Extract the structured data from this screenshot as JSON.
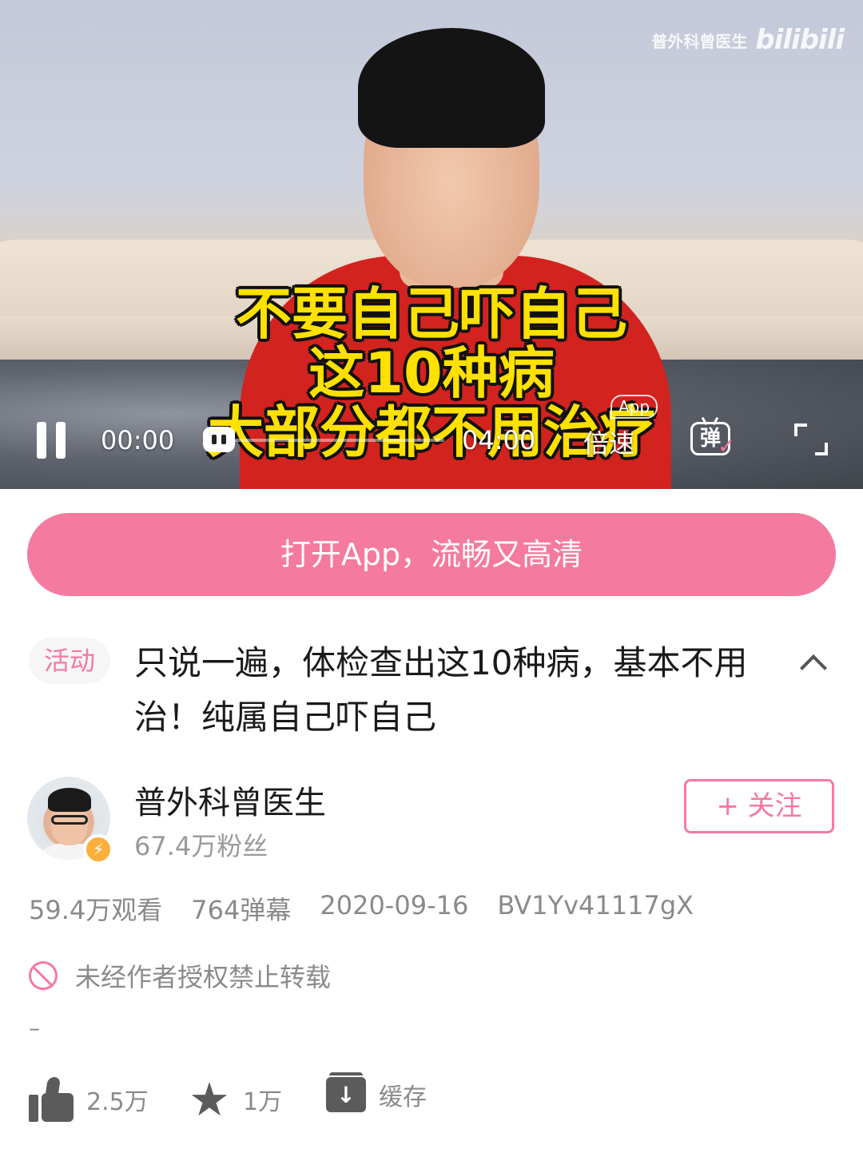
{
  "player": {
    "watermark_author": "普外科曾医生",
    "watermark_logo": "bilibili",
    "caption_lines": [
      "不要自己吓自己",
      "这10种病",
      "大部分都不用治疗"
    ],
    "current_time": "00:00",
    "total_time": "04:00",
    "app_badge": "App",
    "speed_label": "倍速",
    "danmaku_label": "弹",
    "progress_fraction": 0.0,
    "icons": [
      "pause-icon",
      "progress-knob-icon",
      "danmaku-toggle-icon",
      "fullscreen-icon"
    ]
  },
  "open_app": {
    "label": "打开App，流畅又高清"
  },
  "video": {
    "tag": "活动",
    "title": "只说一遍，体检查出这10种病，基本不用治！纯属自己吓自己",
    "collapse_icon": "chevron-up-icon"
  },
  "uploader": {
    "name": "普外科曾医生",
    "fans": "67.4万粉丝",
    "verified_icon": "lightning-badge-icon",
    "follow_label": "+ 关注"
  },
  "stats": {
    "views": "59.4万观看",
    "danmaku": "764弹幕",
    "date": "2020-09-16",
    "bvid": "BV1Yv41117gX"
  },
  "notice": {
    "text": "未经作者授权禁止转载",
    "icon": "ban-icon"
  },
  "description": "–",
  "actions": {
    "like": "2.5万",
    "favorite": "1万",
    "cache": "缓存"
  },
  "colors": {
    "accent": "#f57a9f",
    "caption": "#ffe100",
    "shirt": "#d3231f"
  }
}
